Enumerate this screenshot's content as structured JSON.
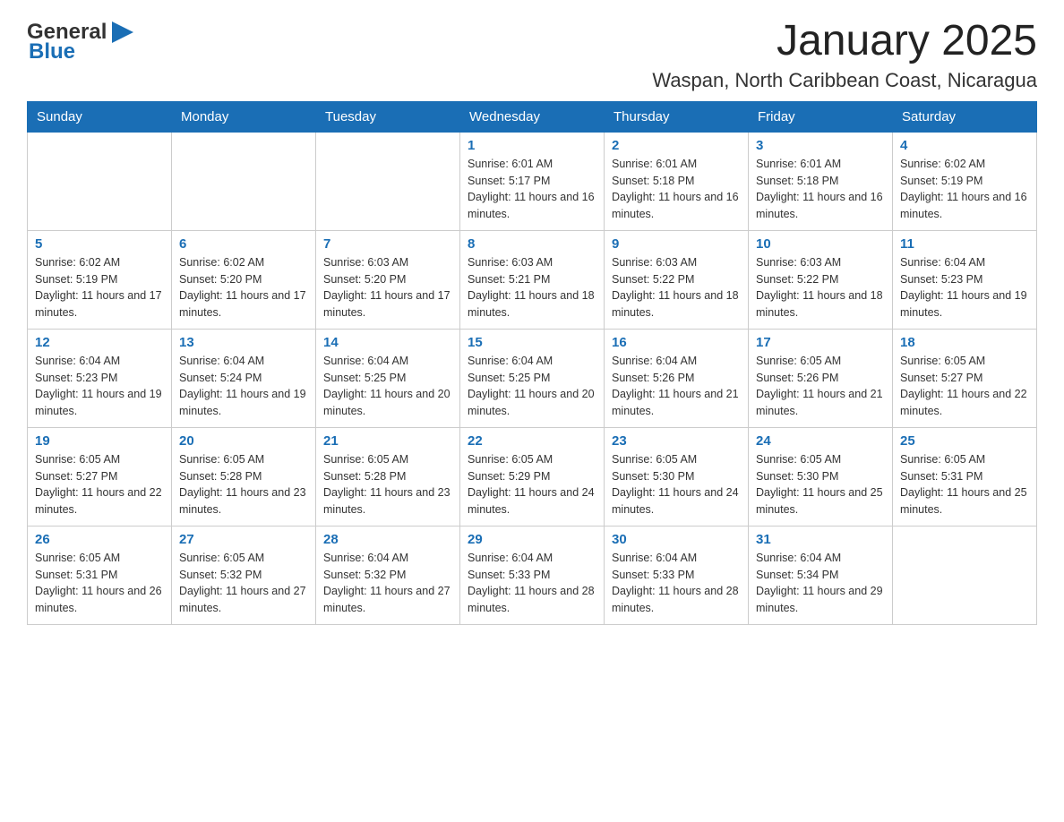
{
  "header": {
    "logo": {
      "general": "General",
      "blue": "Blue",
      "arrow": "▶"
    },
    "month": "January 2025",
    "location": "Waspan, North Caribbean Coast, Nicaragua"
  },
  "days_of_week": [
    "Sunday",
    "Monday",
    "Tuesday",
    "Wednesday",
    "Thursday",
    "Friday",
    "Saturday"
  ],
  "weeks": [
    [
      {
        "day": "",
        "info": ""
      },
      {
        "day": "",
        "info": ""
      },
      {
        "day": "",
        "info": ""
      },
      {
        "day": "1",
        "info": "Sunrise: 6:01 AM\nSunset: 5:17 PM\nDaylight: 11 hours and 16 minutes."
      },
      {
        "day": "2",
        "info": "Sunrise: 6:01 AM\nSunset: 5:18 PM\nDaylight: 11 hours and 16 minutes."
      },
      {
        "day": "3",
        "info": "Sunrise: 6:01 AM\nSunset: 5:18 PM\nDaylight: 11 hours and 16 minutes."
      },
      {
        "day": "4",
        "info": "Sunrise: 6:02 AM\nSunset: 5:19 PM\nDaylight: 11 hours and 16 minutes."
      }
    ],
    [
      {
        "day": "5",
        "info": "Sunrise: 6:02 AM\nSunset: 5:19 PM\nDaylight: 11 hours and 17 minutes."
      },
      {
        "day": "6",
        "info": "Sunrise: 6:02 AM\nSunset: 5:20 PM\nDaylight: 11 hours and 17 minutes."
      },
      {
        "day": "7",
        "info": "Sunrise: 6:03 AM\nSunset: 5:20 PM\nDaylight: 11 hours and 17 minutes."
      },
      {
        "day": "8",
        "info": "Sunrise: 6:03 AM\nSunset: 5:21 PM\nDaylight: 11 hours and 18 minutes."
      },
      {
        "day": "9",
        "info": "Sunrise: 6:03 AM\nSunset: 5:22 PM\nDaylight: 11 hours and 18 minutes."
      },
      {
        "day": "10",
        "info": "Sunrise: 6:03 AM\nSunset: 5:22 PM\nDaylight: 11 hours and 18 minutes."
      },
      {
        "day": "11",
        "info": "Sunrise: 6:04 AM\nSunset: 5:23 PM\nDaylight: 11 hours and 19 minutes."
      }
    ],
    [
      {
        "day": "12",
        "info": "Sunrise: 6:04 AM\nSunset: 5:23 PM\nDaylight: 11 hours and 19 minutes."
      },
      {
        "day": "13",
        "info": "Sunrise: 6:04 AM\nSunset: 5:24 PM\nDaylight: 11 hours and 19 minutes."
      },
      {
        "day": "14",
        "info": "Sunrise: 6:04 AM\nSunset: 5:25 PM\nDaylight: 11 hours and 20 minutes."
      },
      {
        "day": "15",
        "info": "Sunrise: 6:04 AM\nSunset: 5:25 PM\nDaylight: 11 hours and 20 minutes."
      },
      {
        "day": "16",
        "info": "Sunrise: 6:04 AM\nSunset: 5:26 PM\nDaylight: 11 hours and 21 minutes."
      },
      {
        "day": "17",
        "info": "Sunrise: 6:05 AM\nSunset: 5:26 PM\nDaylight: 11 hours and 21 minutes."
      },
      {
        "day": "18",
        "info": "Sunrise: 6:05 AM\nSunset: 5:27 PM\nDaylight: 11 hours and 22 minutes."
      }
    ],
    [
      {
        "day": "19",
        "info": "Sunrise: 6:05 AM\nSunset: 5:27 PM\nDaylight: 11 hours and 22 minutes."
      },
      {
        "day": "20",
        "info": "Sunrise: 6:05 AM\nSunset: 5:28 PM\nDaylight: 11 hours and 23 minutes."
      },
      {
        "day": "21",
        "info": "Sunrise: 6:05 AM\nSunset: 5:28 PM\nDaylight: 11 hours and 23 minutes."
      },
      {
        "day": "22",
        "info": "Sunrise: 6:05 AM\nSunset: 5:29 PM\nDaylight: 11 hours and 24 minutes."
      },
      {
        "day": "23",
        "info": "Sunrise: 6:05 AM\nSunset: 5:30 PM\nDaylight: 11 hours and 24 minutes."
      },
      {
        "day": "24",
        "info": "Sunrise: 6:05 AM\nSunset: 5:30 PM\nDaylight: 11 hours and 25 minutes."
      },
      {
        "day": "25",
        "info": "Sunrise: 6:05 AM\nSunset: 5:31 PM\nDaylight: 11 hours and 25 minutes."
      }
    ],
    [
      {
        "day": "26",
        "info": "Sunrise: 6:05 AM\nSunset: 5:31 PM\nDaylight: 11 hours and 26 minutes."
      },
      {
        "day": "27",
        "info": "Sunrise: 6:05 AM\nSunset: 5:32 PM\nDaylight: 11 hours and 27 minutes."
      },
      {
        "day": "28",
        "info": "Sunrise: 6:04 AM\nSunset: 5:32 PM\nDaylight: 11 hours and 27 minutes."
      },
      {
        "day": "29",
        "info": "Sunrise: 6:04 AM\nSunset: 5:33 PM\nDaylight: 11 hours and 28 minutes."
      },
      {
        "day": "30",
        "info": "Sunrise: 6:04 AM\nSunset: 5:33 PM\nDaylight: 11 hours and 28 minutes."
      },
      {
        "day": "31",
        "info": "Sunrise: 6:04 AM\nSunset: 5:34 PM\nDaylight: 11 hours and 29 minutes."
      },
      {
        "day": "",
        "info": ""
      }
    ]
  ],
  "colors": {
    "header_bg": "#1a6eb5",
    "accent_blue": "#1a6eb5"
  }
}
